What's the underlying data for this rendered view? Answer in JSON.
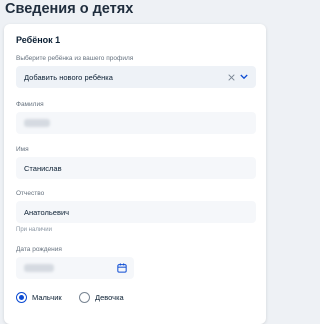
{
  "page": {
    "title": "Сведения о детях"
  },
  "child": {
    "section_title": "Ребёнок 1",
    "select_label": "Выберите ребёнка из вашего профиля",
    "select_value": "Добавить нового ребёнка",
    "surname_label": "Фамилия",
    "name_label": "Имя",
    "name_value": "Станислав",
    "patronymic_label": "Отчество",
    "patronymic_value": "Анатольевич",
    "patronymic_hint": "При наличии",
    "birthdate_label": "Дата рождения",
    "gender": {
      "options": [
        "Мальчик",
        "Девочка"
      ],
      "selected": "Мальчик"
    }
  },
  "colors": {
    "accent": "#0d4cd3",
    "field_bg": "#f5f7fa",
    "page_bg": "#eef1f5"
  },
  "icons": [
    "clear-icon",
    "chevron-down-icon",
    "calendar-icon"
  ]
}
